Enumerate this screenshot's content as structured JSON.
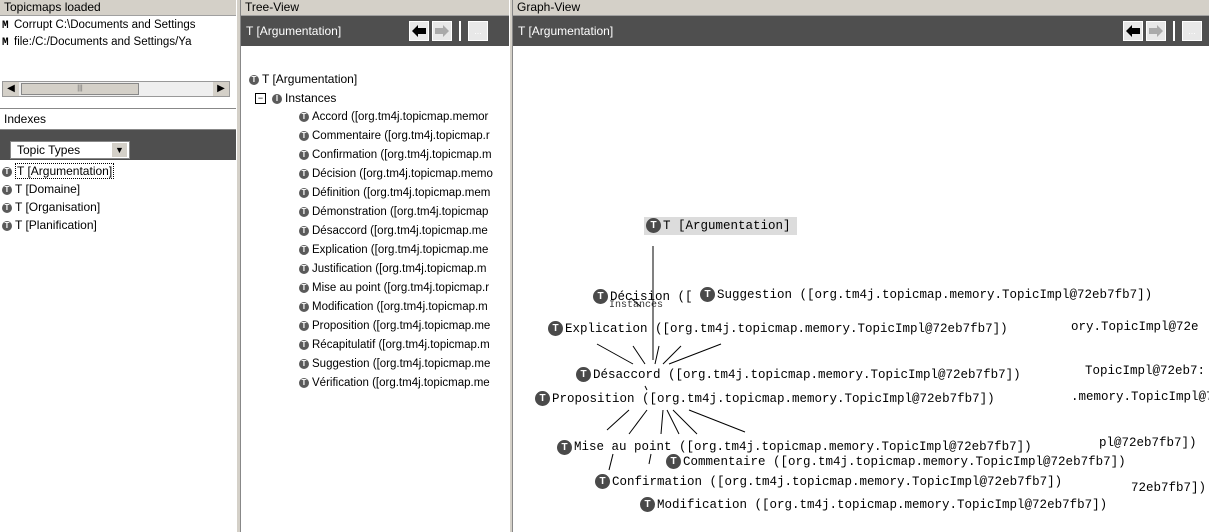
{
  "left": {
    "topicmaps_title": "Topicmaps loaded",
    "topicmaps": [
      {
        "icon": "merged-topicmap-icon",
        "label": "Corrupt C:\\Documents and Settings"
      },
      {
        "icon": "topicmap-file-icon",
        "label": "file:/C:/Documents and Settings/Ya"
      }
    ],
    "indexes_title": "Indexes",
    "index_select": "Topic Types",
    "index_items": [
      "T [Argumentation]",
      "T [Domaine]",
      "T [Organisation]",
      "T [Planification]"
    ]
  },
  "tree": {
    "title": "Tree-View",
    "header": "T [Argumentation]",
    "root": "T [Argumentation]",
    "instances_label": "Instances",
    "items": [
      "Accord ([org.tm4j.topicmap.memor",
      "Commentaire ([org.tm4j.topicmap.r",
      "Confirmation ([org.tm4j.topicmap.m",
      "Décision ([org.tm4j.topicmap.memo",
      "Définition ([org.tm4j.topicmap.mem",
      "Démonstration ([org.tm4j.topicmap",
      "Désaccord ([org.tm4j.topicmap.me",
      "Explication ([org.tm4j.topicmap.me",
      "Justification ([org.tm4j.topicmap.m",
      "Mise au point ([org.tm4j.topicmap.r",
      "Modification ([org.tm4j.topicmap.m",
      "Proposition ([org.tm4j.topicmap.me",
      "Récapitulatif ([org.tm4j.topicmap.m",
      "Suggestion ([org.tm4j.topicmap.me",
      "Vérification ([org.tm4j.topicmap.me"
    ]
  },
  "graph": {
    "title": "Graph-View",
    "header": "T [Argumentation]",
    "root_label": "T [Argumentation]",
    "instances_fragment": "Instances",
    "nodes": {
      "decision": "Décision ([",
      "suggestion": "Suggestion ([org.tm4j.topicmap.memory.TopicImpl@72eb7fb7])",
      "explication": "Explication ([org.tm4j.topicmap.memory.TopicImpl@72eb7fb7])",
      "desaccord": "Désaccord ([org.tm4j.topicmap.memory.TopicImpl@72eb7fb7])",
      "proposition": "Proposition ([org.tm4j.topicmap.memory.TopicImpl@72eb7fb7])",
      "mise_au_point": "Mise au point ([org.tm4j.topicmap.memory.TopicImpl@72eb7fb7])",
      "commentaire": "Commentaire ([org.tm4j.topicmap.memory.TopicImpl@72eb7fb7])",
      "confirmation": "Confirmation ([org.tm4j.topicmap.memory.TopicImpl@72eb7fb7])",
      "modification": "Modification ([org.tm4j.topicmap.memory.TopicImpl@72eb7fb7])"
    },
    "fragments": [
      "ory.TopicImpl@72e",
      "TopicImpl@72eb7:",
      ".memory.TopicImpl@7",
      "pl@72eb7fb7])",
      "72eb7fb7])"
    ]
  },
  "colors": {
    "dark_bar": "#4f4f4f",
    "panel_title_bg": "#d4d0c8",
    "node_bullet": "#4a4a4a",
    "root_node_bg": "#dcdcdc"
  }
}
